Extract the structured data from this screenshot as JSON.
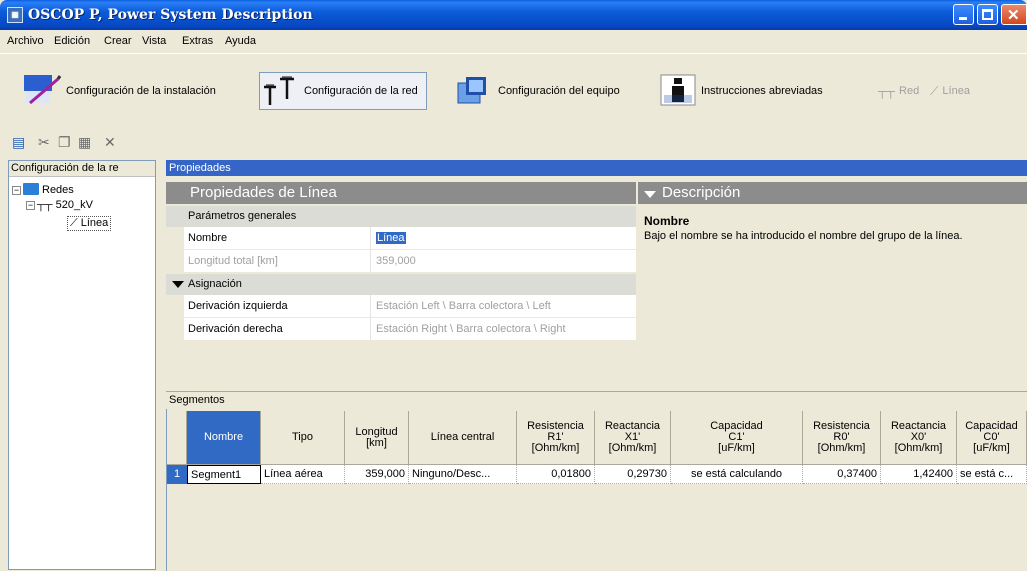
{
  "window": {
    "title": "OSCOP P, Power System Description",
    "app_icon": "oscop-app-icon"
  },
  "menu": [
    "Archivo",
    "Edición",
    "Crear",
    "Vista",
    "Extras",
    "Ayuda"
  ],
  "toolbar": {
    "items": [
      {
        "label": "Configuración de la instalación",
        "icon": "install-config-icon"
      },
      {
        "label": "Configuración de la red",
        "icon": "network-config-icon",
        "active": true
      },
      {
        "label": "Configuración del equipo",
        "icon": "device-config-icon"
      },
      {
        "label": "Instrucciones abreviadas",
        "icon": "info-icon"
      },
      {
        "label": "Red",
        "icon": "network-icon",
        "disabled": true
      },
      {
        "label": "Línea",
        "icon": "line-icon",
        "disabled": true
      }
    ]
  },
  "tree": {
    "header": "Configuración de la re",
    "nodes": [
      {
        "label": "Redes",
        "expander": "−"
      },
      {
        "label": "520_kV",
        "expander": "−"
      },
      {
        "label": "Línea"
      }
    ]
  },
  "properties": {
    "panel_title": "Propiedades",
    "section_title": "Propiedades de Línea",
    "group_general": "Parámetros generales",
    "rows_general": [
      {
        "label": "Nombre",
        "value": "Línea"
      },
      {
        "label": "Longitud total [km]",
        "value": "359,000"
      }
    ],
    "group_assignment": "Asignación",
    "rows_assignment": [
      {
        "label": "Derivación izquierda",
        "value": "Estación Left \\ Barra colectora \\ Left"
      },
      {
        "label": "Derivación derecha",
        "value": "Estación Right \\ Barra colectora \\ Right"
      }
    ],
    "description": {
      "title": "Descripción",
      "name_heading": "Nombre",
      "text": "Bajo el nombre se ha introducido el nombre del grupo de la línea."
    }
  },
  "segments": {
    "panel_title": "Segmentos",
    "pin": "ᵽ",
    "columns": [
      [
        "Nombre"
      ],
      [
        "Tipo"
      ],
      [
        "Longitud",
        "[km]"
      ],
      [
        "Línea central"
      ],
      [
        "Resistencia",
        "R1'",
        "[Ohm/km]"
      ],
      [
        "Reactancia",
        "X1'",
        "[Ohm/km]"
      ],
      [
        "Capacidad",
        "C1'",
        "[uF/km]"
      ],
      [
        "Resistencia",
        "R0'",
        "[Ohm/km]"
      ],
      [
        "Reactancia",
        "X0'",
        "[Ohm/km]"
      ],
      [
        "Capacidad",
        "C0'",
        "[uF/km]"
      ]
    ],
    "rows": [
      {
        "num": "1",
        "cells": [
          "Segment1",
          "Línea aérea",
          "359,000",
          "Ninguno/Desc...",
          "0,01800",
          "0,29730",
          "se está calculando",
          "0,37400",
          "1,42400",
          "se está c..."
        ]
      }
    ]
  }
}
